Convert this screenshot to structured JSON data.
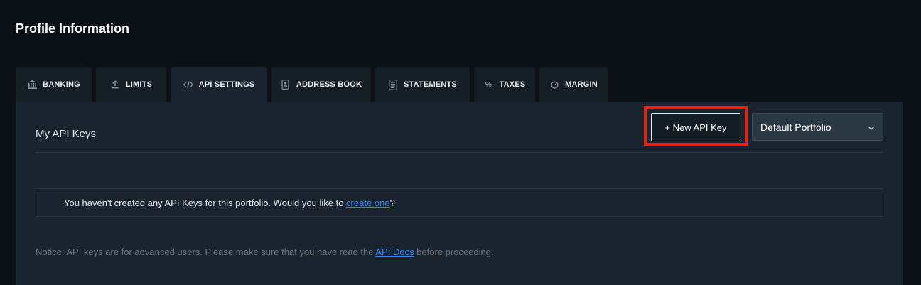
{
  "page": {
    "title": "Profile Information"
  },
  "tabs": [
    {
      "label": "BANKING",
      "icon": "bank-icon",
      "active": false
    },
    {
      "label": "LIMITS",
      "icon": "upload-arrow-icon",
      "active": false
    },
    {
      "label": "API SETTINGS",
      "icon": "code-icon",
      "active": true
    },
    {
      "label": "ADDRESS BOOK",
      "icon": "address-book-icon",
      "active": false
    },
    {
      "label": "STATEMENTS",
      "icon": "document-icon",
      "active": false
    },
    {
      "label": "TAXES",
      "icon": "percent-icon",
      "active": false
    },
    {
      "label": "MARGIN",
      "icon": "gauge-icon",
      "active": false
    }
  ],
  "api_keys": {
    "title": "My API Keys",
    "new_key_label": "+ New API Key",
    "portfolio_selected": "Default Portfolio",
    "empty_message_prefix": "You haven't created any API Keys for this portfolio. Would you like to ",
    "empty_message_link": "create one",
    "empty_message_suffix": "?",
    "notice_prefix": "Notice: API keys are for advanced users. Please make sure that you have read the ",
    "notice_link": "API Docs",
    "notice_suffix": " before proceeding."
  },
  "colors": {
    "background": "#0b1116",
    "panel": "#1a242e",
    "tab": "#151d25",
    "link": "#2f8cff",
    "highlight": "#e8200f"
  }
}
